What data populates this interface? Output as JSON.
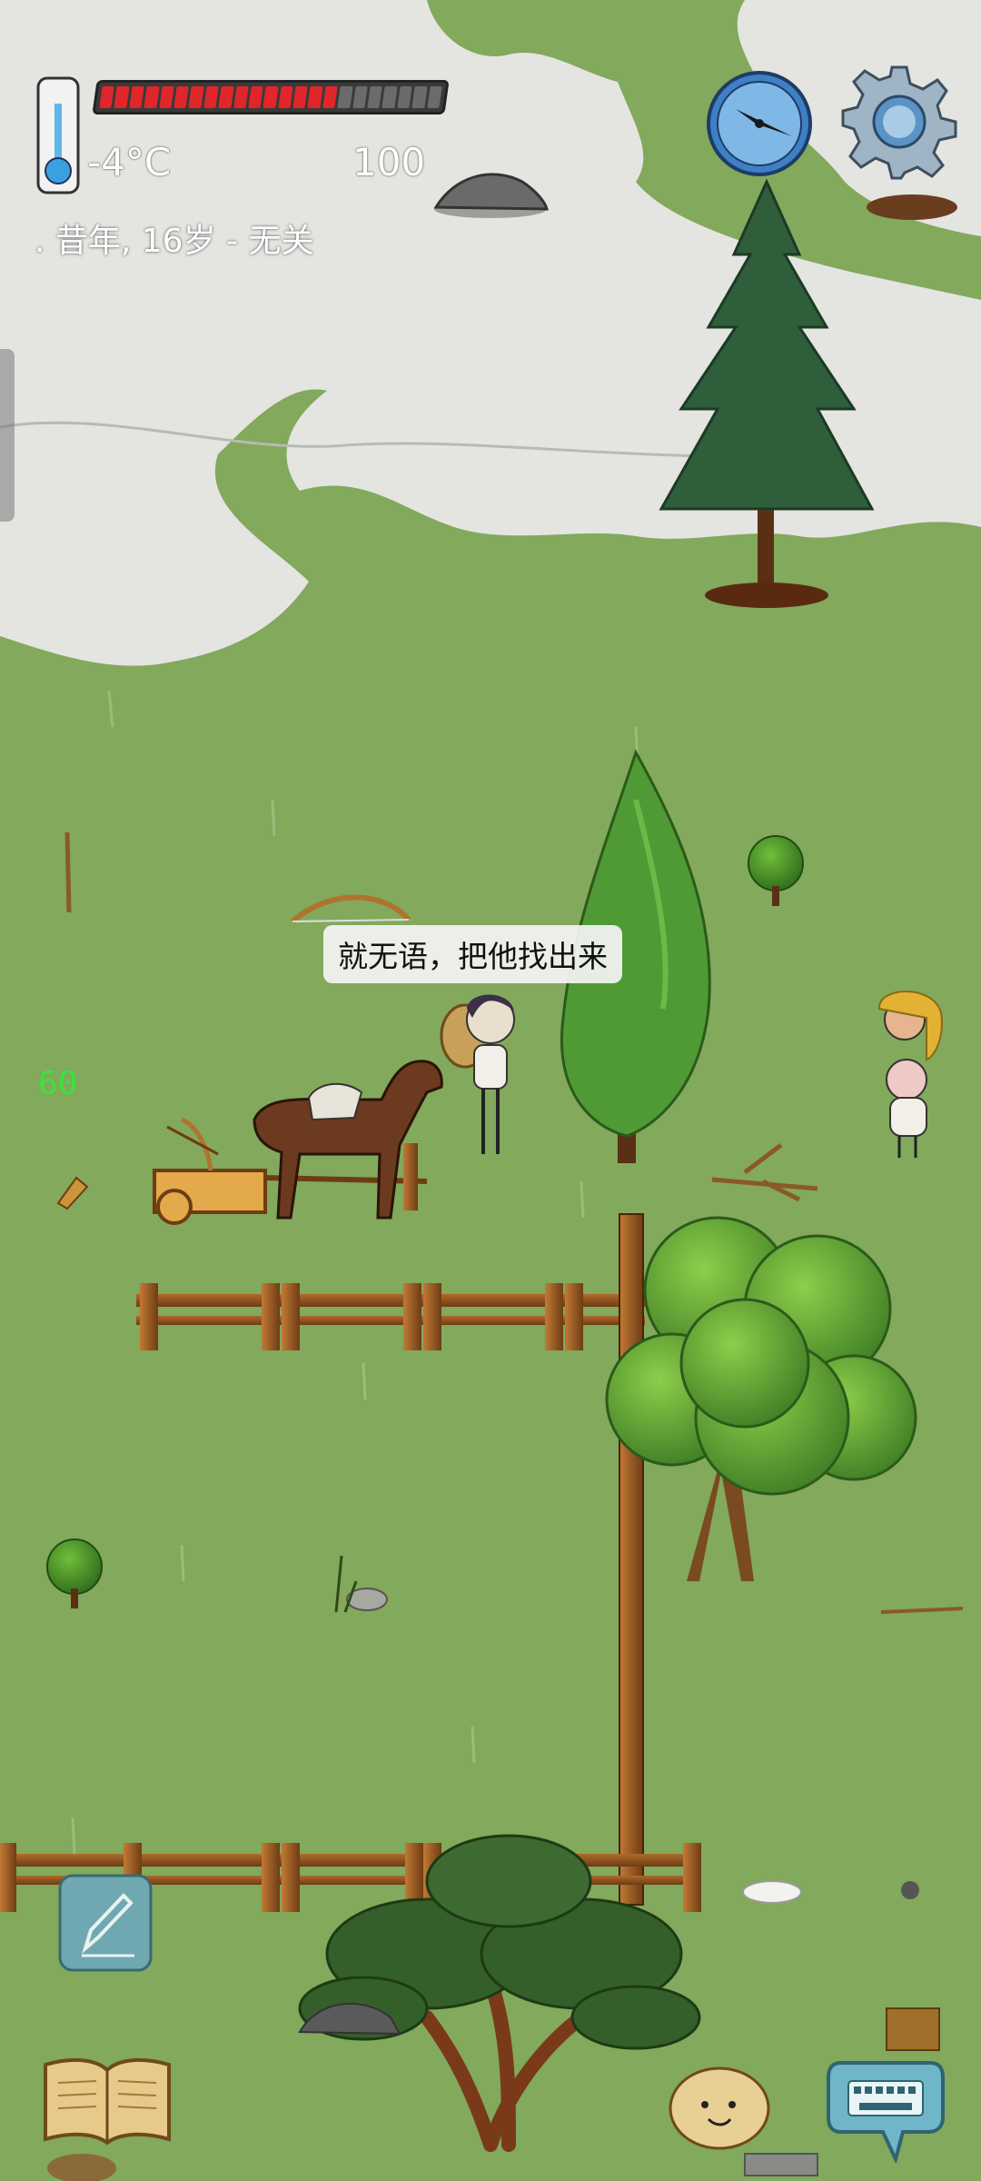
{
  "hud": {
    "temperature": "-4°C",
    "food": "100",
    "status": ". 昔年, 16岁 - 无关",
    "health_fraction": 0.7,
    "health_segments_total": 23,
    "health_segments_filled": 16,
    "compass_icon": "compass-icon",
    "settings_icon": "gear-icon",
    "thermometer_icon": "thermometer-icon"
  },
  "speech": {
    "text": "就无语，把他找出来"
  },
  "debug": {
    "fps": "60"
  },
  "buttons": {
    "pencil_icon": "pencil-icon",
    "book_icon": "book-icon",
    "emote_icon": "face-icon",
    "keyboard_icon": "keyboard-icon"
  },
  "colors": {
    "health": "#e0262b",
    "health_empty": "#6b6b6b",
    "grass": "#7fa659",
    "snow": "#e6e6e3",
    "fps": "#3be33b"
  }
}
